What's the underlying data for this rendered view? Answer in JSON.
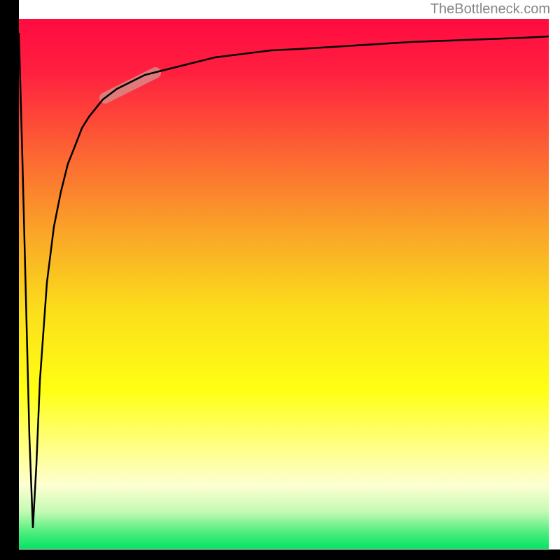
{
  "watermark": "TheBottleneck.com",
  "chart_data": {
    "type": "line",
    "title": "",
    "xlabel": "",
    "ylabel": "",
    "xlim": [
      0,
      100
    ],
    "ylim": [
      0,
      100
    ],
    "highlight_region": {
      "x_start": 16,
      "x_end": 26,
      "note": "semi-transparent pill marker on curve"
    },
    "series": [
      {
        "name": "bottleneck-curve",
        "note": "Curve starts high at x=0, drops sharply to near 0 around x~2.5, then rises asymptotically toward ~95-97. Y values are approximate percentages read from pixel position within a 0-100 normalized plot.",
        "x": [
          0,
          0.7,
          1.3,
          2.0,
          2.6,
          3.3,
          4.0,
          5.3,
          6.6,
          7.9,
          9.2,
          10.6,
          11.9,
          13.2,
          15.9,
          18.5,
          21.1,
          23.8,
          26.4,
          31.7,
          37.0,
          42.3,
          47.6,
          52.8,
          63.4,
          74.0,
          84.5,
          95.1,
          100.0
        ],
        "values": [
          97.4,
          73.6,
          47.6,
          21.1,
          4.0,
          15.9,
          31.7,
          50.2,
          60.8,
          67.4,
          72.7,
          76.0,
          79.4,
          81.5,
          84.8,
          86.8,
          88.1,
          89.4,
          90.1,
          91.4,
          92.7,
          93.4,
          94.0,
          94.3,
          95.0,
          95.6,
          96.0,
          96.4,
          96.7
        ]
      }
    ],
    "background_gradient": {
      "type": "vertical",
      "stops": [
        {
          "pos": 0.0,
          "color": "#ff0b40"
        },
        {
          "pos": 0.1,
          "color": "#ff1f3f"
        },
        {
          "pos": 0.25,
          "color": "#fc6333"
        },
        {
          "pos": 0.4,
          "color": "#faa428"
        },
        {
          "pos": 0.55,
          "color": "#fbde1b"
        },
        {
          "pos": 0.7,
          "color": "#ffff13"
        },
        {
          "pos": 0.8,
          "color": "#ffff7e"
        },
        {
          "pos": 0.88,
          "color": "#fdffd1"
        },
        {
          "pos": 0.93,
          "color": "#c4fab3"
        },
        {
          "pos": 0.97,
          "color": "#4bed7c"
        },
        {
          "pos": 1.0,
          "color": "#03e464"
        }
      ]
    }
  }
}
